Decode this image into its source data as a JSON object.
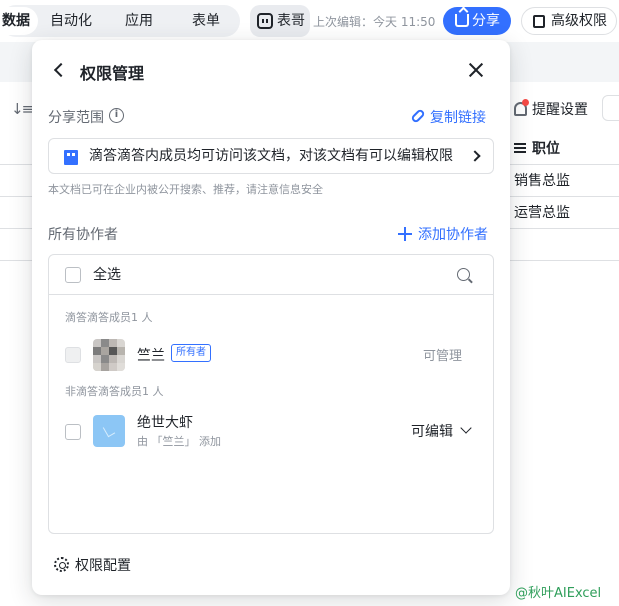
{
  "topbar": {
    "tabs": [
      "数据",
      "自动化",
      "应用",
      "表单"
    ],
    "assistant_label": "表哥",
    "last_edit": "上次编辑：今天 11:50",
    "share_label": "分享",
    "advanced_permission_label": "高级权限"
  },
  "sheet": {
    "remind_label": "提醒设置",
    "column_header": "职位",
    "rows": [
      "销售总监",
      "运营总监"
    ]
  },
  "modal": {
    "title": "权限管理",
    "share_scope_label": "分享范围",
    "copy_link_label": "复制链接",
    "scope_text": "滴答滴答内成员均可访问该文档，对该文档有可以编辑权限",
    "notice": "本文档已可在企业内被公开搜索、推荐，请注意信息安全",
    "collaborators_label": "所有协作者",
    "add_collaborator_label": "添加协作者",
    "select_all_label": "全选",
    "groups": [
      {
        "label": "滴答滴答成员1 人",
        "members": [
          {
            "name": "竺兰",
            "tag": "所有者",
            "permission": "可管理"
          }
        ]
      },
      {
        "label": "非滴答滴答成员1 人",
        "members": [
          {
            "name": "绝世大虾",
            "added_by": "由 「竺兰」 添加",
            "permission": "可编辑"
          }
        ]
      }
    ],
    "permission_config_label": "权限配置"
  },
  "watermark": "@秋叶AIExcel",
  "colors": {
    "accent": "#3370ff",
    "watermark": "#2f9e5a"
  }
}
